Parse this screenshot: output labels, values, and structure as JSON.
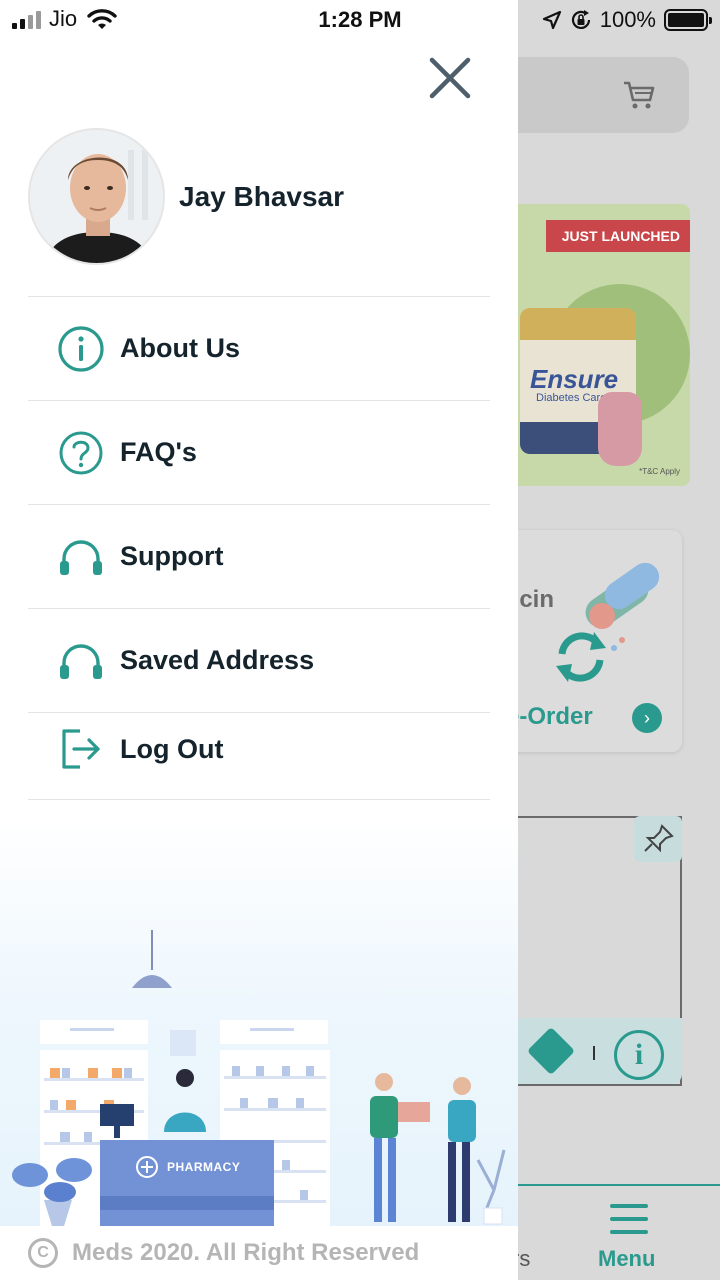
{
  "status_bar": {
    "carrier": "Jio",
    "time": "1:28 PM",
    "battery_percent": "100%",
    "signal_bars_active": 2
  },
  "drawer": {
    "user_name": "Jay Bhavsar",
    "menu_items": [
      {
        "label": "About Us",
        "icon": "info-circle-icon"
      },
      {
        "label": "FAQ's",
        "icon": "question-circle-icon"
      },
      {
        "label": "Support",
        "icon": "headphones-icon"
      },
      {
        "label": "Saved Address",
        "icon": "headphones-icon"
      },
      {
        "label": "Log Out",
        "icon": "logout-icon"
      }
    ],
    "illustration": {
      "pharmacy_sign": "PHARMACY"
    },
    "footer": {
      "copyright_symbol": "C",
      "copyright_text": "Meds 2020. All Right Reserved"
    }
  },
  "background": {
    "banner_ribbon": "JUST LAUNCHED",
    "banner_brand": "Ensure",
    "banner_sub": "Diabetes Care",
    "banner_tc": "*T&C Apply",
    "card_title_partial": "dicin",
    "reorder_partial": "e-Order",
    "tab_orders_partial": "rs",
    "tab_menu": "Menu"
  },
  "colors": {
    "accent": "#2b9a8e",
    "text_dark": "#14232c",
    "muted": "#b5b5b5",
    "divider": "#e4e4e4"
  }
}
